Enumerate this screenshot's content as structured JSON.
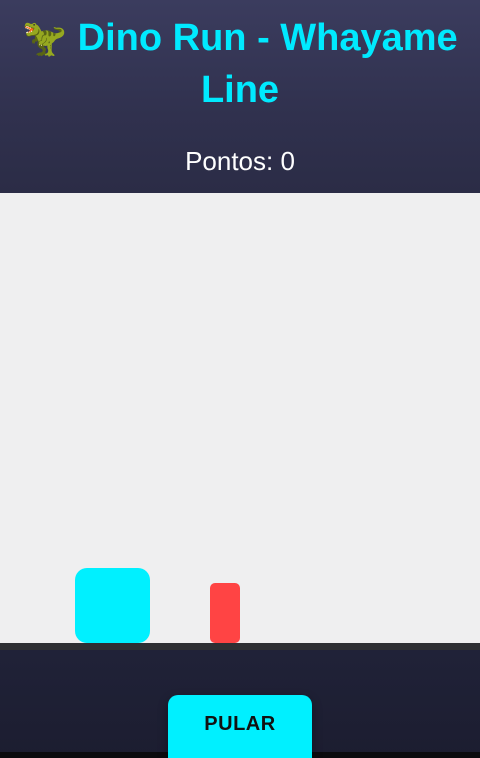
{
  "header": {
    "title_emoji": "🦖",
    "title_text": "Dino Run - Whayame Line",
    "score_label": "Pontos: 0"
  },
  "game": {
    "player": {
      "icon": "dino-block",
      "color": "#00f0ff"
    },
    "obstacle": {
      "icon": "cactus-block",
      "color": "#ff4444"
    }
  },
  "controls": {
    "jump_label": "PULAR",
    "jump_color": "#00f0ff"
  }
}
